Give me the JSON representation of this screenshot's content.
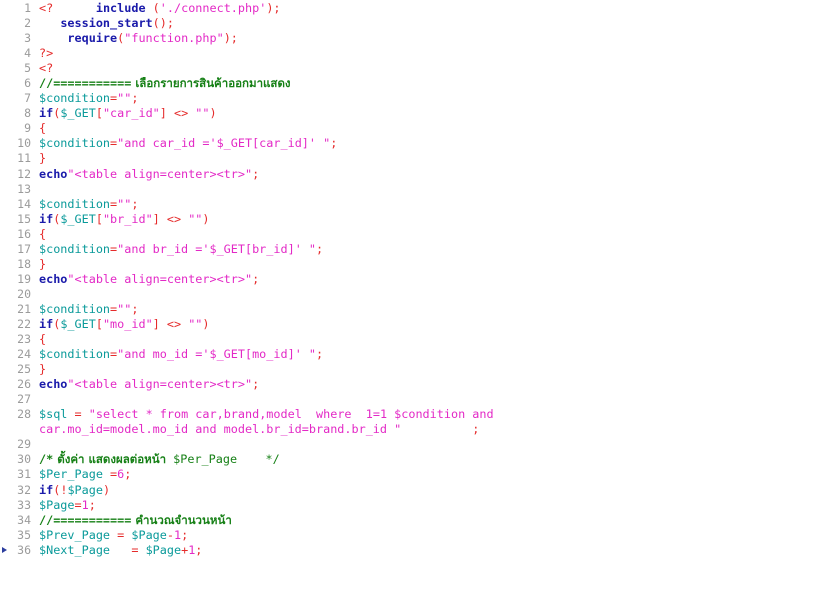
{
  "editor": {
    "language": "PHP",
    "background_color": "#ffffff",
    "gutter_color": "#9b9b9b",
    "colors": {
      "tag": "#e52b2b",
      "keyword": "#1a1aaa",
      "variable": "#0a9a9a",
      "string": "#e329c6",
      "number": "#e329c6",
      "operator": "#e52b2b",
      "comment": "#168016",
      "marker": "#2c3e9e"
    },
    "marker_line": 36,
    "first_visible_line": 1,
    "last_visible_line": 36
  },
  "lines": [
    {
      "num": "1",
      "marker": false,
      "text": "<?      include ('./connect.php');"
    },
    {
      "num": "2",
      "marker": false,
      "text": "   session_start();"
    },
    {
      "num": "3",
      "marker": false,
      "text": "    require(\"function.php\");"
    },
    {
      "num": "4",
      "marker": false,
      "text": "?>"
    },
    {
      "num": "5",
      "marker": false,
      "text": "<?"
    },
    {
      "num": "6",
      "marker": false,
      "text": "//=========== เลือกรายการสินค้าออกมาแสดง"
    },
    {
      "num": "7",
      "marker": false,
      "text": "$condition=\"\";"
    },
    {
      "num": "8",
      "marker": false,
      "text": "if($_GET[\"car_id\"] <> \"\")"
    },
    {
      "num": "9",
      "marker": false,
      "text": "{"
    },
    {
      "num": "10",
      "marker": false,
      "text": "$condition=\"and car_id ='$_GET[car_id]' \";"
    },
    {
      "num": "11",
      "marker": false,
      "text": "}"
    },
    {
      "num": "12",
      "marker": false,
      "text": "echo\"<table align=center><tr>\";"
    },
    {
      "num": "13",
      "marker": false,
      "text": ""
    },
    {
      "num": "14",
      "marker": false,
      "text": "$condition=\"\";"
    },
    {
      "num": "15",
      "marker": false,
      "text": "if($_GET[\"br_id\"] <> \"\")"
    },
    {
      "num": "16",
      "marker": false,
      "text": "{"
    },
    {
      "num": "17",
      "marker": false,
      "text": "$condition=\"and br_id ='$_GET[br_id]' \";"
    },
    {
      "num": "18",
      "marker": false,
      "text": "}"
    },
    {
      "num": "19",
      "marker": false,
      "text": "echo\"<table align=center><tr>\";"
    },
    {
      "num": "20",
      "marker": false,
      "text": ""
    },
    {
      "num": "21",
      "marker": false,
      "text": "$condition=\"\";"
    },
    {
      "num": "22",
      "marker": false,
      "text": "if($_GET[\"mo_id\"] <> \"\")"
    },
    {
      "num": "23",
      "marker": false,
      "text": "{"
    },
    {
      "num": "24",
      "marker": false,
      "text": "$condition=\"and mo_id ='$_GET[mo_id]' \";"
    },
    {
      "num": "25",
      "marker": false,
      "text": "}"
    },
    {
      "num": "26",
      "marker": false,
      "text": "echo\"<table align=center><tr>\";"
    },
    {
      "num": "27",
      "marker": false,
      "text": ""
    },
    {
      "num": "28",
      "marker": false,
      "text": "$sql = \"select * from car,brand,model  where  1=1 $condition and"
    },
    {
      "num": "",
      "marker": false,
      "text": "car.mo_id=model.mo_id and model.br_id=brand.br_id \"          ;"
    },
    {
      "num": "29",
      "marker": false,
      "text": ""
    },
    {
      "num": "30",
      "marker": false,
      "text": "/* ตั้งค่า แสดงผลต่อหน้า $Per_Page    */"
    },
    {
      "num": "31",
      "marker": false,
      "text": "$Per_Page =6;"
    },
    {
      "num": "32",
      "marker": false,
      "text": "if(!$Page)"
    },
    {
      "num": "33",
      "marker": false,
      "text": "$Page=1;"
    },
    {
      "num": "34",
      "marker": false,
      "text": "//=========== คำนวณจำนวนหน้า"
    },
    {
      "num": "35",
      "marker": false,
      "text": "$Prev_Page = $Page-1;"
    },
    {
      "num": "36",
      "marker": true,
      "text": "$Next_Page   = $Page+1;"
    }
  ],
  "comments_thai": {
    "line6": "เลือกรายการสินค้าออกมาแสดง",
    "line30": "ตั้งค่า แสดงผลต่อหน้า",
    "line34": "คำนวณจำนวนหน้า"
  }
}
